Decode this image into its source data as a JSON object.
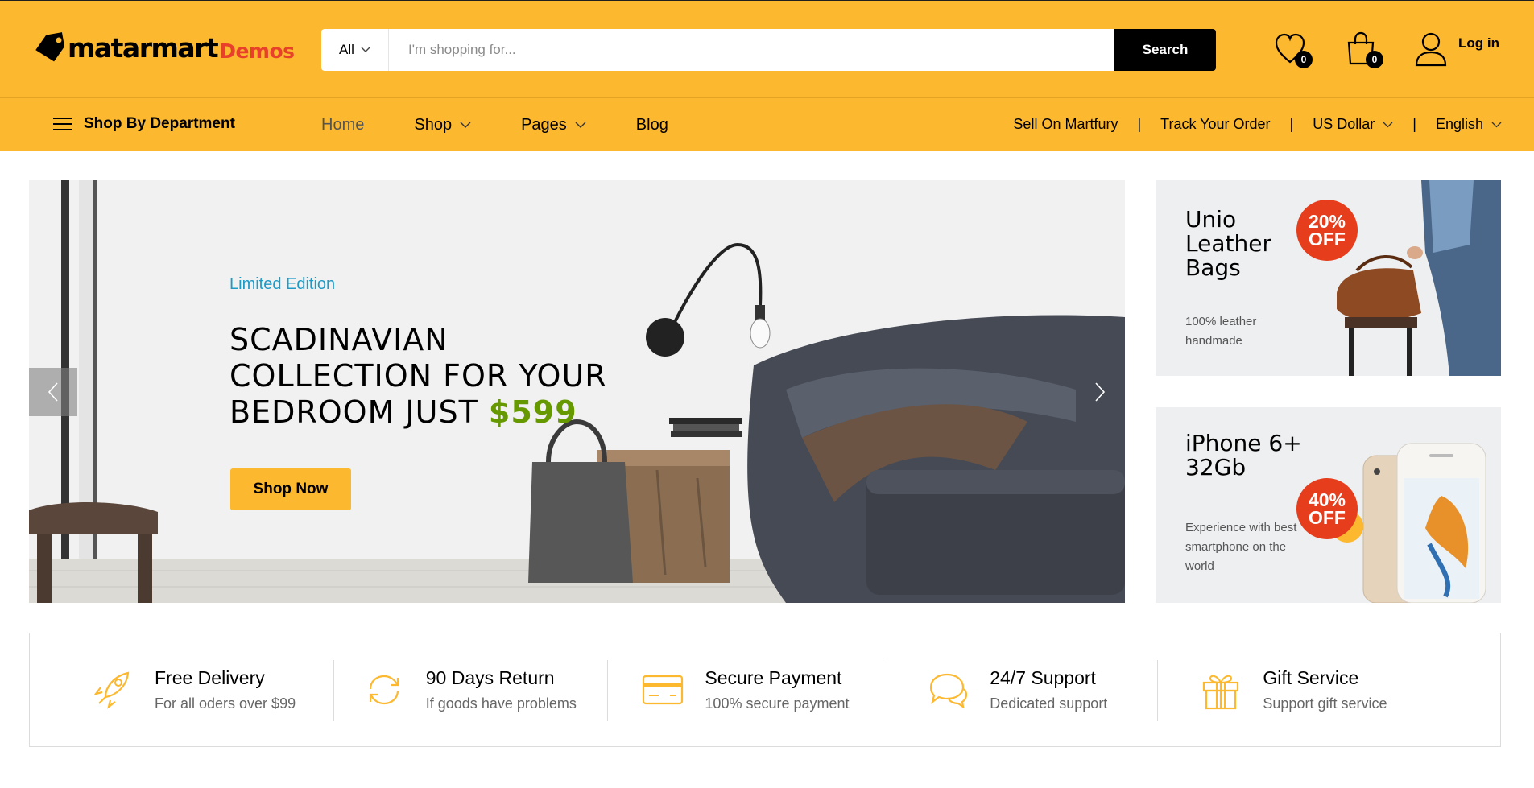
{
  "header": {
    "logo_text": "matarmart",
    "logo_suffix": "Demos",
    "search": {
      "category": "All",
      "placeholder": "I'm shopping for...",
      "button_label": "Search"
    },
    "wishlist_count": "0",
    "cart_count": "0",
    "login_label": "Log in"
  },
  "nav": {
    "department_label": "Shop By Department",
    "menu": [
      {
        "label": "Home"
      },
      {
        "label": "Shop"
      },
      {
        "label": "Pages"
      },
      {
        "label": "Blog"
      }
    ],
    "sell_label": "Sell On Martfury",
    "track_label": "Track Your Order",
    "currency": "US Dollar",
    "language": "English",
    "separator": "|"
  },
  "hero": {
    "tag": "Limited Edition",
    "title_lines": [
      "SCADINAVIAN",
      "COLLECTION FOR YOUR",
      "BEDROOM JUST"
    ],
    "price": "$599",
    "button_label": "Shop Now"
  },
  "promos": [
    {
      "title": "Unio Leather Bags",
      "description": "100% leather handmade",
      "discount_pct": "20%",
      "discount_word": "OFF"
    },
    {
      "title": "iPhone 6+ 32Gb",
      "description": "Experience with best smartphone on the world",
      "discount_pct": "40%",
      "discount_word": "OFF"
    }
  ],
  "features": [
    {
      "icon": "rocket-icon",
      "title": "Free Delivery",
      "subtitle": "For all oders over $99"
    },
    {
      "icon": "return-icon",
      "title": "90 Days Return",
      "subtitle": "If goods have problems"
    },
    {
      "icon": "credit-card-icon",
      "title": "Secure Payment",
      "subtitle": "100% secure payment"
    },
    {
      "icon": "chat-icon",
      "title": "24/7 Support",
      "subtitle": "Dedicated support"
    },
    {
      "icon": "gift-icon",
      "title": "Gift Service",
      "subtitle": "Support gift service"
    }
  ],
  "colors": {
    "brand_yellow": "#fcb82f",
    "accent_red": "#e63e1d",
    "price_green": "#669900",
    "tag_blue": "#1d9ac6"
  }
}
